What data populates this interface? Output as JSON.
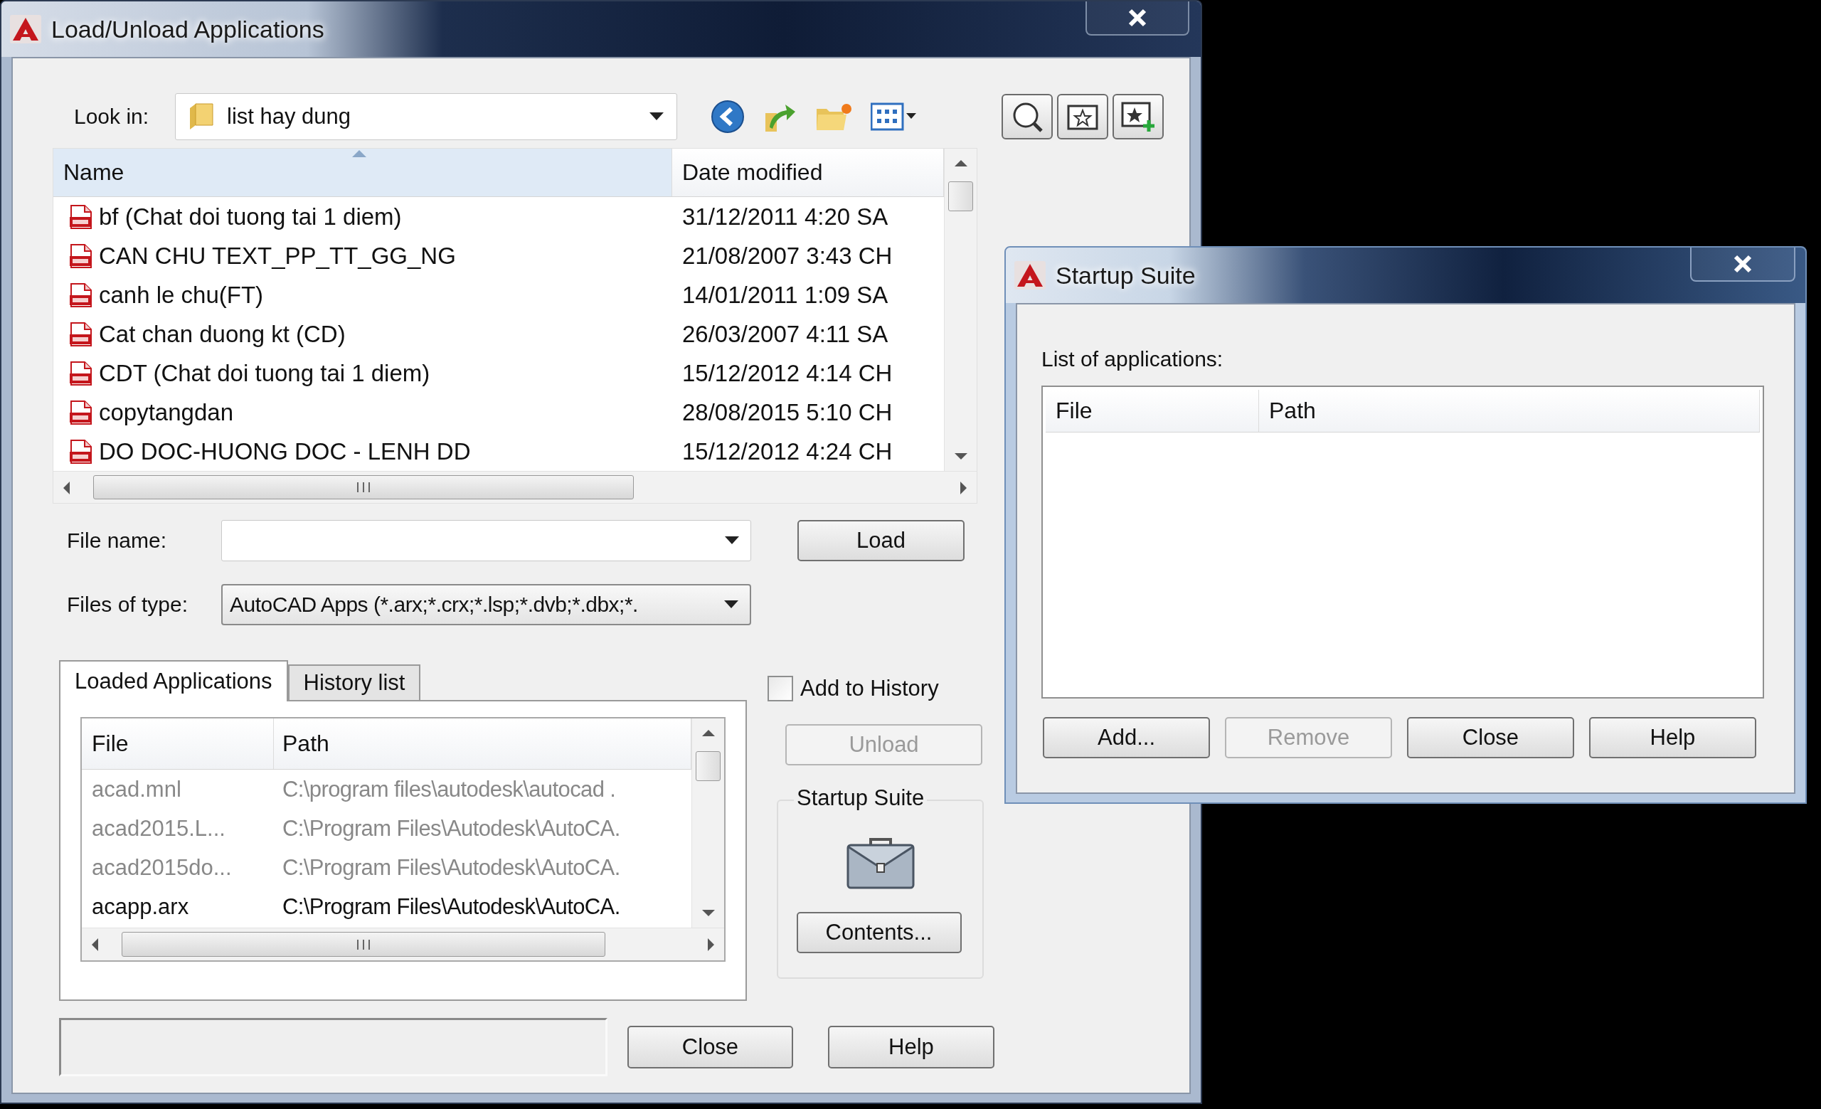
{
  "load_dialog": {
    "title": "Load/Unload Applications",
    "look_in": {
      "label": "Look in:",
      "value": "list hay dung"
    },
    "file_list": {
      "columns": [
        "Name",
        "Date modified"
      ],
      "rows": [
        {
          "name": "bf (Chat doi tuong tai 1 diem)",
          "date": "31/12/2011 4:20 SA"
        },
        {
          "name": "CAN CHU TEXT_PP_TT_GG_NG",
          "date": "21/08/2007 3:43 CH"
        },
        {
          "name": "canh le chu(FT)",
          "date": "14/01/2011 1:09 SA"
        },
        {
          "name": "Cat chan duong kt (CD)",
          "date": "26/03/2007 4:11 SA"
        },
        {
          "name": "CDT (Chat doi tuong tai 1 diem)",
          "date": "15/12/2012 4:14 CH"
        },
        {
          "name": "copytangdan",
          "date": "28/08/2015 5:10 CH"
        },
        {
          "name": "DO DOC-HUONG DOC - LENH DD",
          "date": "15/12/2012 4:24 CH"
        }
      ]
    },
    "file_name": {
      "label": "File name:"
    },
    "files_of_type": {
      "label": "Files of type:",
      "value": "AutoCAD Apps (*.arx;*.crx;*.lsp;*.dvb;*.dbx;*."
    },
    "load_button": "Load",
    "tabs": [
      {
        "label": "Loaded Applications",
        "selected": true
      },
      {
        "label": "History list",
        "selected": false
      }
    ],
    "loaded_list": {
      "columns": [
        "File",
        "Path"
      ],
      "rows": [
        {
          "file": "acad.mnl",
          "path": "C:\\program files\\autodesk\\autocad .",
          "dimmed": true
        },
        {
          "file": "acad2015.L...",
          "path": "C:\\Program Files\\Autodesk\\AutoCA.",
          "dimmed": true
        },
        {
          "file": "acad2015do...",
          "path": "C:\\Program Files\\Autodesk\\AutoCA.",
          "dimmed": true
        },
        {
          "file": "acapp.arx",
          "path": "C:\\Program Files\\Autodesk\\AutoCA.",
          "dimmed": false
        }
      ]
    },
    "add_to_history": {
      "label": "Add to History",
      "checked": false
    },
    "unload_button": {
      "label": "Unload",
      "disabled": true
    },
    "startup_suite": {
      "label": "Startup Suite",
      "button": "Contents..."
    },
    "buttons": [
      "Close",
      "Help"
    ]
  },
  "startup_dialog": {
    "title": "Startup Suite",
    "list_label": "List of applications:",
    "columns": [
      "File",
      "Path"
    ],
    "buttons": [
      {
        "label": "Add...",
        "disabled": false
      },
      {
        "label": "Remove",
        "disabled": true
      },
      {
        "label": "Close",
        "disabled": false
      },
      {
        "label": "Help",
        "disabled": false
      }
    ]
  }
}
